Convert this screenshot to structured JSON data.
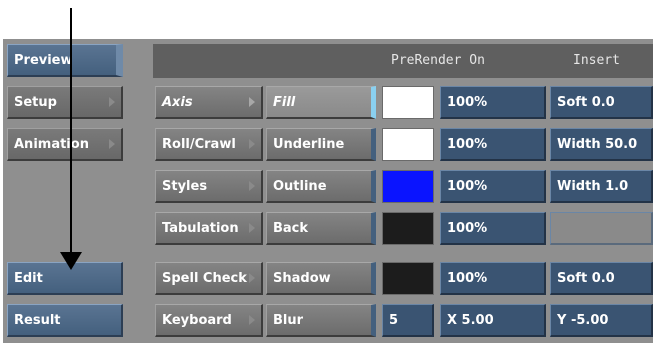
{
  "header": {
    "prerender": "PreRender On",
    "insert": "Insert"
  },
  "left_menu": {
    "preview": "Preview",
    "setup": "Setup",
    "animation": "Animation",
    "edit": "Edit",
    "result": "Result"
  },
  "col1": {
    "axis": "Axis",
    "roll_crawl": "Roll/Crawl",
    "styles": "Styles",
    "tabulation": "Tabulation",
    "spell_check": "Spell Check",
    "keyboard": "Keyboard"
  },
  "col2": {
    "fill": "Fill",
    "underline": "Underline",
    "outline": "Outline",
    "back": "Back",
    "shadow": "Shadow",
    "blur": "Blur"
  },
  "swatches": {
    "fill": "#ffffff",
    "underline": "#ffffff",
    "outline": "#0a14ff",
    "back": "#1c1c1c",
    "shadow": "#1c1c1c"
  },
  "blur_value": "5",
  "percent": {
    "fill": "100%",
    "underline": "100%",
    "outline": "100%",
    "back": "100%",
    "shadow": "100%"
  },
  "blur_x": "X 5.00",
  "right_col": {
    "fill": "Soft 0.0",
    "underline": "Width 50.0",
    "outline": "Width 1.0",
    "shadow": "Soft 0.0",
    "blur_y": "Y -5.00"
  }
}
